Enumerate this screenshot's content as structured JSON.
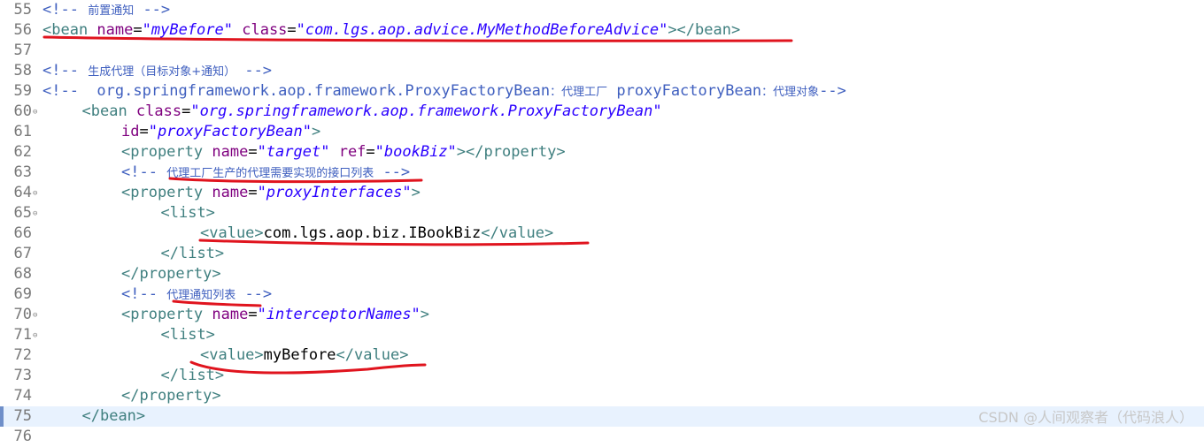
{
  "editor": {
    "current_line": 75,
    "lines": [
      {
        "n": "55",
        "fold": false,
        "indent": 0,
        "tokens": [
          {
            "c": "com",
            "t": "<!-- "
          },
          {
            "c": "com cjk",
            "t": "前置通知"
          },
          {
            "c": "com",
            "t": " -->"
          }
        ]
      },
      {
        "n": "56",
        "fold": false,
        "indent": 0,
        "tokens": [
          {
            "c": "tag",
            "t": "<bean "
          },
          {
            "c": "attr",
            "t": "name"
          },
          {
            "c": "text",
            "t": "="
          },
          {
            "c": "val",
            "t": "\"myBefore\""
          },
          {
            "c": "text",
            "t": " "
          },
          {
            "c": "attr",
            "t": "class"
          },
          {
            "c": "text",
            "t": "="
          },
          {
            "c": "val",
            "t": "\"com.lgs.aop.advice.MyMethodBeforeAdvice\""
          },
          {
            "c": "tag",
            "t": "></bean>"
          }
        ]
      },
      {
        "n": "57",
        "fold": false,
        "indent": 0,
        "tokens": []
      },
      {
        "n": "58",
        "fold": false,
        "indent": 0,
        "tokens": [
          {
            "c": "com",
            "t": "<!-- "
          },
          {
            "c": "com cjk",
            "t": "生成代理（目标对象+通知）"
          },
          {
            "c": "com",
            "t": " -->"
          }
        ]
      },
      {
        "n": "59",
        "fold": false,
        "indent": 0,
        "tokens": [
          {
            "c": "com",
            "t": "<!--  org.springframework.aop.framework.ProxyFactoryBean"
          },
          {
            "c": "com cjk",
            "t": "：代理工厂"
          },
          {
            "c": "com",
            "t": " proxyFactoryBean"
          },
          {
            "c": "com cjk",
            "t": "：代理对象"
          },
          {
            "c": "com",
            "t": "-->"
          }
        ]
      },
      {
        "n": "60",
        "fold": true,
        "indent": 1,
        "tokens": [
          {
            "c": "tag",
            "t": "<bean "
          },
          {
            "c": "attr",
            "t": "class"
          },
          {
            "c": "text",
            "t": "="
          },
          {
            "c": "val",
            "t": "\"org.springframework.aop.framework.ProxyFactoryBean\""
          }
        ]
      },
      {
        "n": "61",
        "fold": false,
        "indent": 2,
        "tokens": [
          {
            "c": "attr",
            "t": "id"
          },
          {
            "c": "text",
            "t": "="
          },
          {
            "c": "val",
            "t": "\"proxyFactoryBean\""
          },
          {
            "c": "tag",
            "t": ">"
          }
        ]
      },
      {
        "n": "62",
        "fold": false,
        "indent": 2,
        "tokens": [
          {
            "c": "tag",
            "t": "<property "
          },
          {
            "c": "attr",
            "t": "name"
          },
          {
            "c": "text",
            "t": "="
          },
          {
            "c": "val",
            "t": "\"target\""
          },
          {
            "c": "text",
            "t": " "
          },
          {
            "c": "attr",
            "t": "ref"
          },
          {
            "c": "text",
            "t": "="
          },
          {
            "c": "val",
            "t": "\"bookBiz\""
          },
          {
            "c": "tag",
            "t": "></property>"
          }
        ]
      },
      {
        "n": "63",
        "fold": false,
        "indent": 2,
        "tokens": [
          {
            "c": "com",
            "t": "<!-- "
          },
          {
            "c": "com cjk",
            "t": "代理工厂生产的代理需要实现的接口列表"
          },
          {
            "c": "com",
            "t": " -->"
          }
        ]
      },
      {
        "n": "64",
        "fold": true,
        "indent": 2,
        "tokens": [
          {
            "c": "tag",
            "t": "<property "
          },
          {
            "c": "attr",
            "t": "name"
          },
          {
            "c": "text",
            "t": "="
          },
          {
            "c": "val",
            "t": "\"proxyInterfaces\""
          },
          {
            "c": "tag",
            "t": ">"
          }
        ]
      },
      {
        "n": "65",
        "fold": true,
        "indent": 3,
        "tokens": [
          {
            "c": "tag",
            "t": "<list>"
          }
        ]
      },
      {
        "n": "66",
        "fold": false,
        "indent": 4,
        "tokens": [
          {
            "c": "tag",
            "t": "<value>"
          },
          {
            "c": "text",
            "t": "com.lgs.aop.biz.IBookBiz"
          },
          {
            "c": "tag",
            "t": "</value>"
          }
        ]
      },
      {
        "n": "67",
        "fold": false,
        "indent": 3,
        "tokens": [
          {
            "c": "tag",
            "t": "</list>"
          }
        ]
      },
      {
        "n": "68",
        "fold": false,
        "indent": 2,
        "tokens": [
          {
            "c": "tag",
            "t": "</property>"
          }
        ]
      },
      {
        "n": "69",
        "fold": false,
        "indent": 2,
        "tokens": [
          {
            "c": "com",
            "t": "<!-- "
          },
          {
            "c": "com cjk",
            "t": "代理通知列表"
          },
          {
            "c": "com",
            "t": " -->"
          }
        ]
      },
      {
        "n": "70",
        "fold": true,
        "indent": 2,
        "tokens": [
          {
            "c": "tag",
            "t": "<property "
          },
          {
            "c": "attr",
            "t": "name"
          },
          {
            "c": "text",
            "t": "="
          },
          {
            "c": "val",
            "t": "\"interceptorNames\""
          },
          {
            "c": "tag",
            "t": ">"
          }
        ]
      },
      {
        "n": "71",
        "fold": true,
        "indent": 3,
        "tokens": [
          {
            "c": "tag",
            "t": "<list>"
          }
        ]
      },
      {
        "n": "72",
        "fold": false,
        "indent": 4,
        "tokens": [
          {
            "c": "tag",
            "t": "<value>"
          },
          {
            "c": "text",
            "t": "myBefore"
          },
          {
            "c": "tag",
            "t": "</value>"
          }
        ]
      },
      {
        "n": "73",
        "fold": false,
        "indent": 3,
        "tokens": [
          {
            "c": "tag",
            "t": "</list>"
          }
        ]
      },
      {
        "n": "74",
        "fold": false,
        "indent": 2,
        "tokens": [
          {
            "c": "tag",
            "t": "</property>"
          }
        ]
      },
      {
        "n": "75",
        "fold": false,
        "indent": 1,
        "tokens": [
          {
            "c": "tag",
            "t": "</bean>"
          }
        ]
      },
      {
        "n": "76",
        "fold": false,
        "indent": 0,
        "tokens": []
      }
    ]
  },
  "fold_glyph": "⊖",
  "annotation": {
    "color": "#e0141e"
  },
  "watermark": "CSDN @人间观察者（代码浪人）"
}
